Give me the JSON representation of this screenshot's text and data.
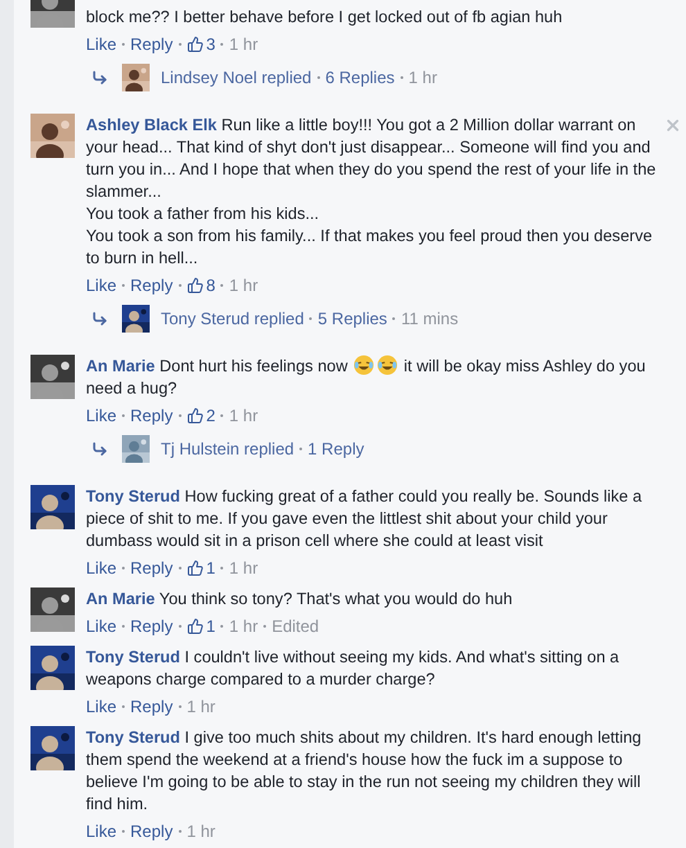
{
  "comments": [
    {
      "text": "block me?? I better behave before I get locked out of fb agian huh",
      "like": "Like",
      "reply": "Reply",
      "likes": "3",
      "time": "1 hr",
      "closable": false,
      "replies": {
        "name": "Lindsey Noel",
        "text": "replied",
        "count": "6 Replies",
        "time": "1 hr"
      }
    },
    {
      "author": "Ashley Black Elk",
      "text": "Run like a little boy!!! You got a 2 Million dollar warrant on your head... That kind of shyt don't just disappear... Someone will find you and turn you in... And I hope that when they do you spend the rest of your life in the slammer...\nYou took a father from his kids...\nYou took a son from his family... If that makes you feel proud then you deserve to burn in hell...",
      "like": "Like",
      "reply": "Reply",
      "likes": "8",
      "time": "1 hr",
      "closable": true,
      "replies": {
        "name": "Tony Sterud",
        "text": "replied",
        "count": "5 Replies",
        "time": "11 mins"
      }
    },
    {
      "author": "An Marie",
      "parts": [
        {
          "kind": "text",
          "text": "Dont hurt his feelings now"
        },
        {
          "kind": "emoji"
        },
        {
          "kind": "emoji"
        },
        {
          "kind": "text",
          "text": "it will be okay miss Ashley do you need a hug?"
        }
      ],
      "like": "Like",
      "reply": "Reply",
      "likes": "2",
      "time": "1 hr",
      "closable": false,
      "replies": {
        "name": "Tj Hulstein",
        "text": "replied",
        "count": "1 Reply"
      }
    },
    {
      "author": "Tony Sterud",
      "text": "How fucking great of a father could you really be. Sounds like a piece of shit to me. If you gave even the littlest shit about your child your dumbass would sit in a prison cell where she could at least visit",
      "like": "Like",
      "reply": "Reply",
      "likes": "1",
      "time": "1 hr",
      "closable": false
    },
    {
      "author": "An Marie",
      "text": "You think so tony? That's what you would do huh",
      "like": "Like",
      "reply": "Reply",
      "likes": "1",
      "time": "1 hr",
      "edited": "Edited",
      "closable": false
    },
    {
      "author": "Tony Sterud",
      "text": "I couldn't live without seeing my kids. And what's sitting on a weapons charge compared to a murder charge?",
      "like": "Like",
      "reply": "Reply",
      "time": "1 hr",
      "closable": false
    },
    {
      "author": "Tony Sterud",
      "text": "I give too much shits about my children. It's hard enough letting them spend the weekend at a friend's house how the fuck im a suppose to believe I'm going to be able to stay in the run not seeing my children they will find him.",
      "like": "Like",
      "reply": "Reply",
      "time": "1 hr",
      "closable": false
    }
  ]
}
